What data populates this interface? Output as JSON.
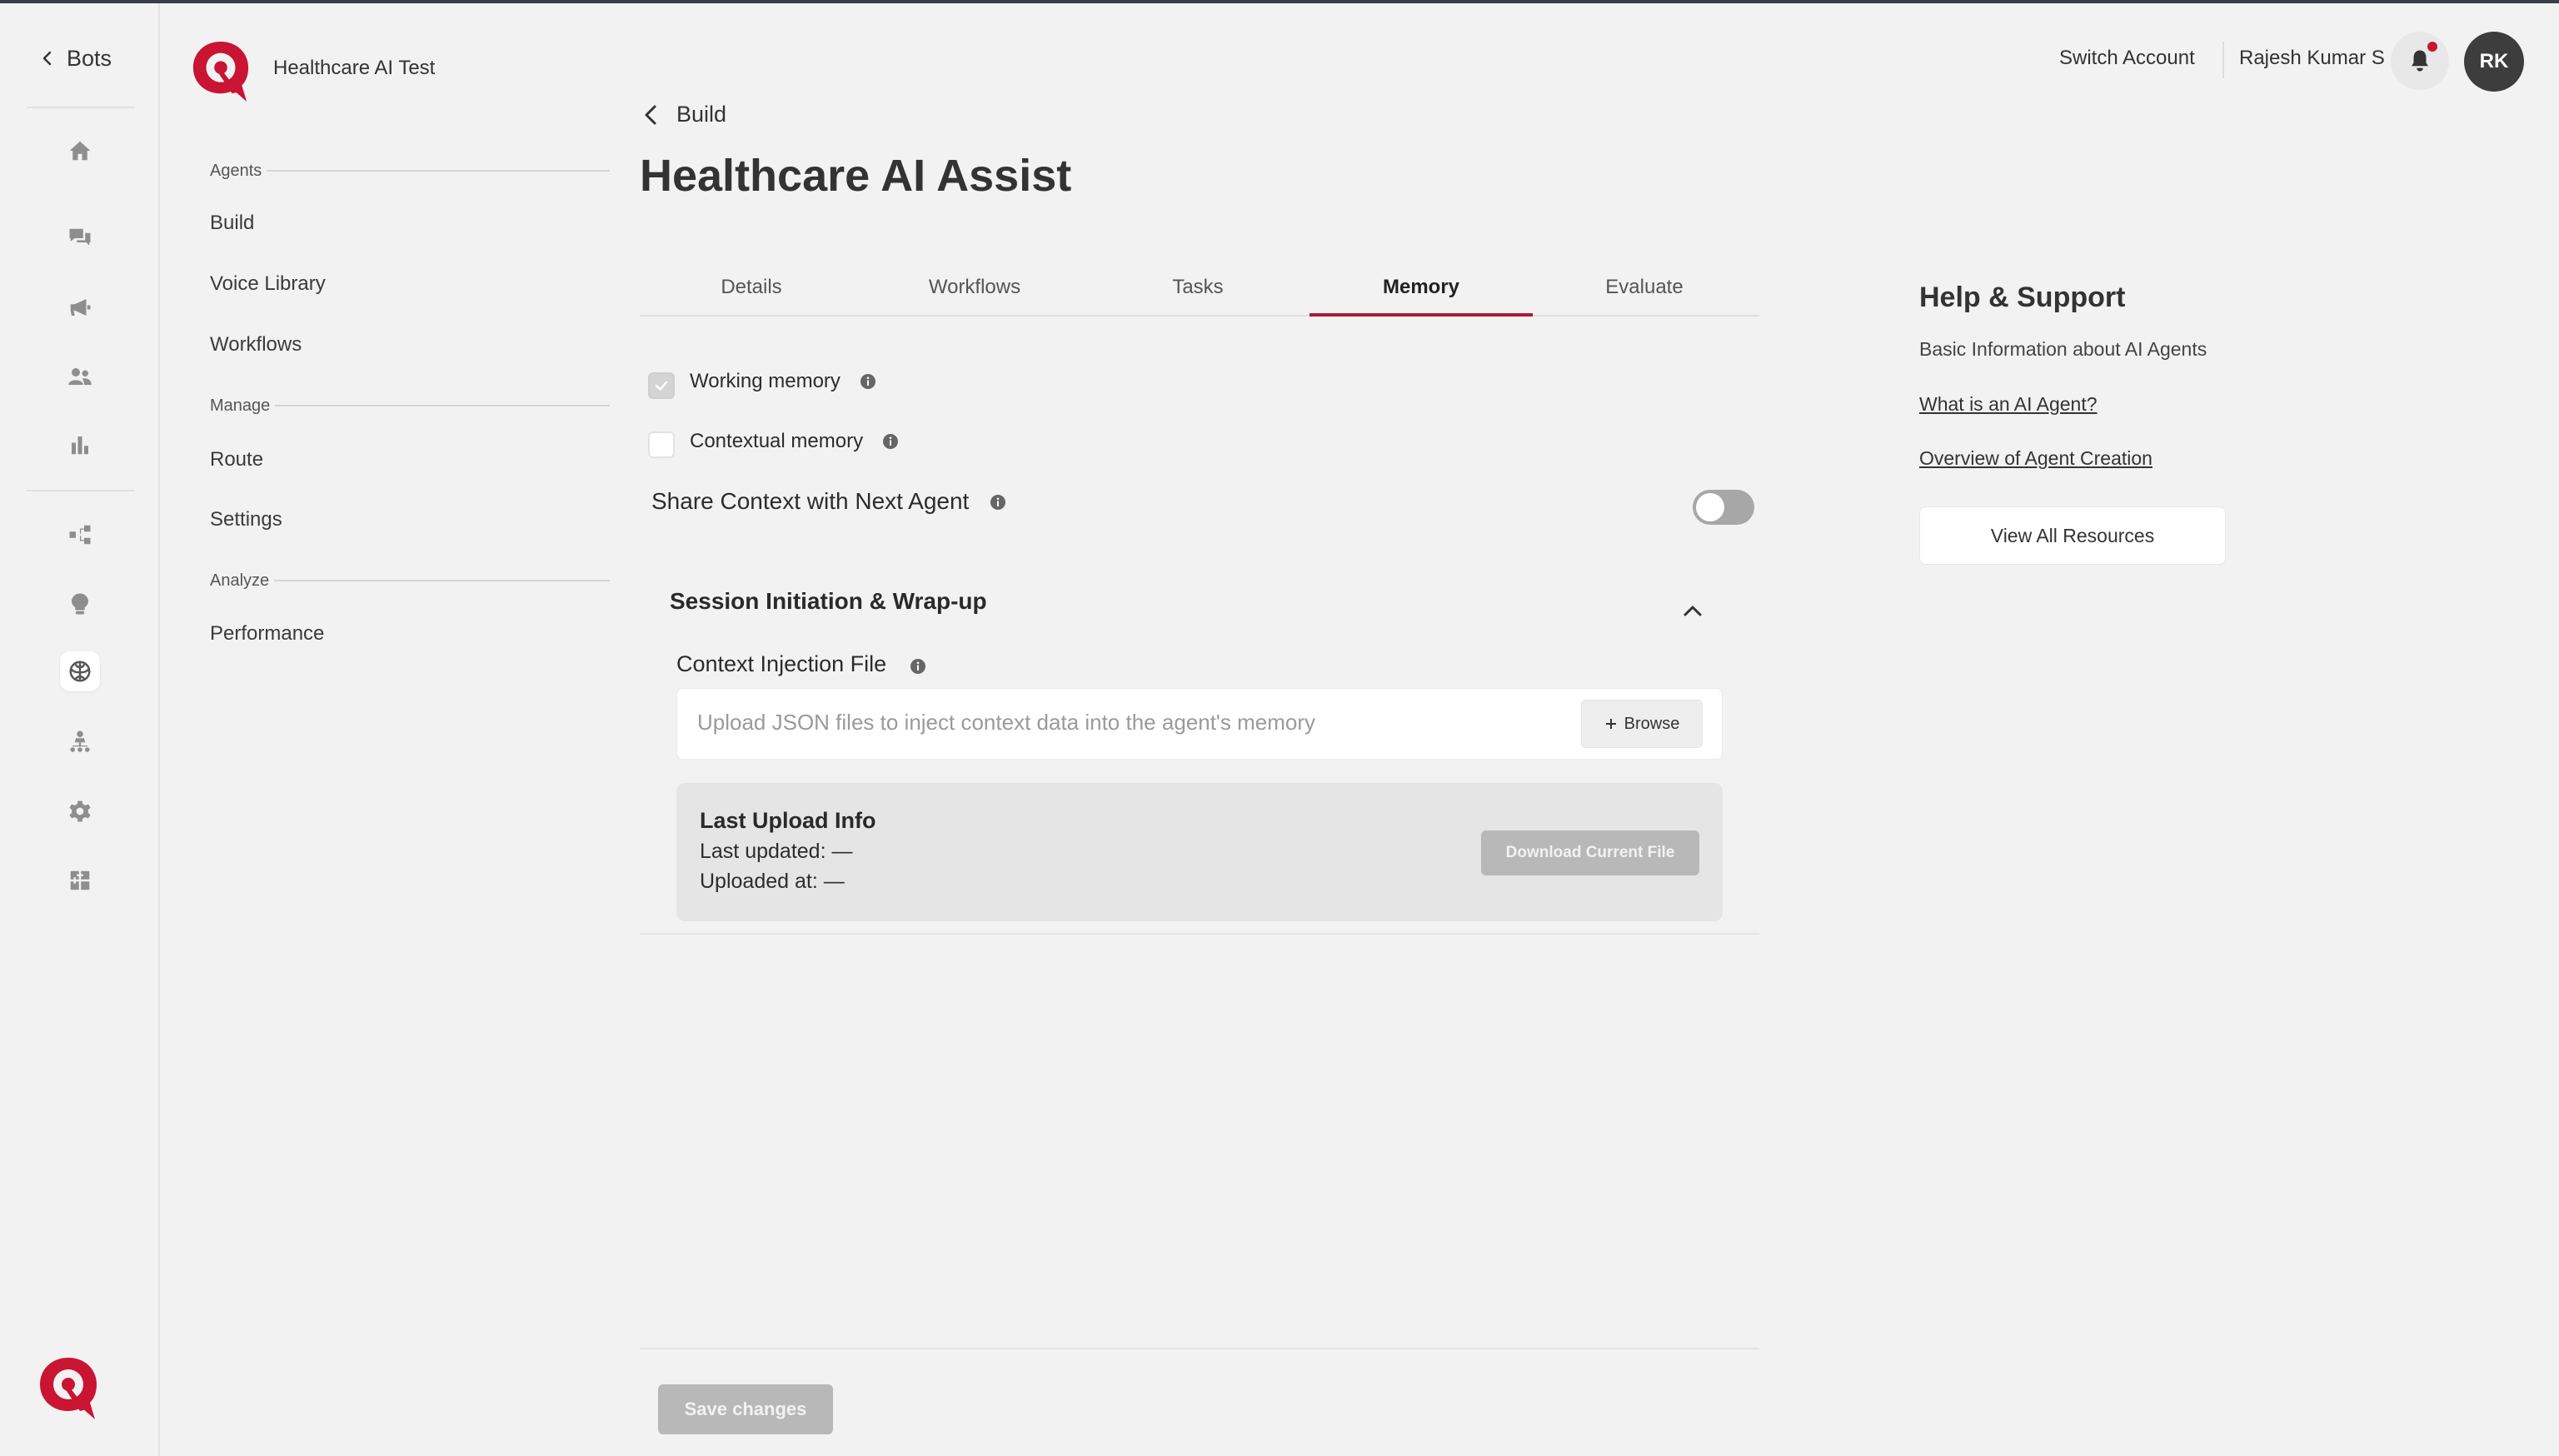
{
  "rail": {
    "back_label": "Bots",
    "icons": [
      "home-icon",
      "chat-icon",
      "megaphone-icon",
      "users-icon",
      "bar-chart-icon",
      "flow-icon",
      "bulb-icon",
      "brain-icon",
      "hierarchy-icon",
      "gear-icon",
      "puzzle-icon"
    ]
  },
  "workspace": {
    "name": "Healthcare AI Test"
  },
  "nav": {
    "groups": [
      {
        "label": "Agents",
        "items": [
          "Build",
          "Voice Library",
          "Workflows"
        ]
      },
      {
        "label": "Manage",
        "items": [
          "Route",
          "Settings"
        ]
      },
      {
        "label": "Analyze",
        "items": [
          "Performance"
        ]
      }
    ]
  },
  "header": {
    "switch_account": "Switch Account",
    "user_name": "Rajesh Kumar S",
    "avatar_initials": "RK"
  },
  "main": {
    "back_label": "Build",
    "title": "Healthcare AI Assist",
    "tabs": [
      "Details",
      "Workflows",
      "Tasks",
      "Memory",
      "Evaluate"
    ],
    "active_tab": "Memory",
    "options": [
      {
        "label": "Working memory",
        "checked": true
      },
      {
        "label": "Contextual memory",
        "checked": false
      }
    ],
    "share_context": {
      "label": "Share Context with Next Agent",
      "enabled": false
    },
    "section": {
      "title": "Session Initiation & Wrap-up",
      "file_label": "Context Injection File",
      "upload_placeholder": "Upload JSON files to inject context data into the agent's memory",
      "browse_label": "Browse",
      "last_upload": {
        "title": "Last Upload Info",
        "updated": "Last updated: —",
        "uploaded_at": "Uploaded at: —",
        "download_label": "Download Current File"
      }
    },
    "save_label": "Save changes"
  },
  "help": {
    "title": "Help & Support",
    "subtitle": "Basic Information about AI Agents",
    "links": [
      "What is an AI Agent?",
      "Overview of Agent Creation"
    ],
    "button": "View All Resources"
  },
  "colors": {
    "accent": "#b01a36",
    "brand": "#c91432",
    "disabled": "#b9b8b9"
  }
}
